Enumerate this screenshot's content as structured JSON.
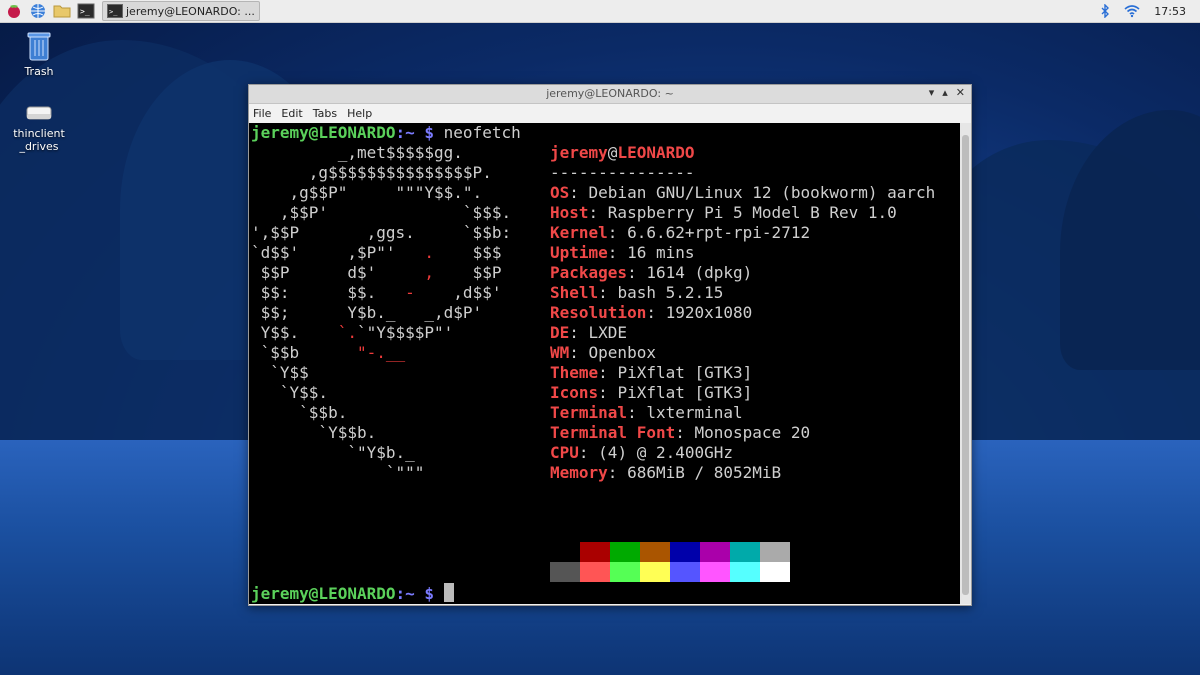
{
  "taskbar": {
    "task_label": "jeremy@LEONARDO: ...",
    "clock": "17:53"
  },
  "desktop": {
    "trash_label": "Trash",
    "drive_label": "thinclient_drives"
  },
  "window": {
    "title": "jeremy@LEONARDO: ~",
    "menu": [
      "File",
      "Edit",
      "Tabs",
      "Help"
    ]
  },
  "terminal": {
    "prompt_user": "jeremy@LEONARDO",
    "prompt_path": ":~",
    "prompt_sign": " $",
    "command": " neofetch",
    "info_user": "jeremy",
    "info_at": "@",
    "info_host": "LEONARDO",
    "separator": "---------------",
    "info": [
      {
        "key": "OS",
        "value": "Debian GNU/Linux 12 (bookworm) aarch"
      },
      {
        "key": "Host",
        "value": "Raspberry Pi 5 Model B Rev 1.0"
      },
      {
        "key": "Kernel",
        "value": "6.6.62+rpt-rpi-2712"
      },
      {
        "key": "Uptime",
        "value": "16 mins"
      },
      {
        "key": "Packages",
        "value": "1614 (dpkg)"
      },
      {
        "key": "Shell",
        "value": "bash 5.2.15"
      },
      {
        "key": "Resolution",
        "value": "1920x1080"
      },
      {
        "key": "DE",
        "value": "LXDE"
      },
      {
        "key": "WM",
        "value": "Openbox"
      },
      {
        "key": "Theme",
        "value": "PiXflat [GTK3]"
      },
      {
        "key": "Icons",
        "value": "PiXflat [GTK3]"
      },
      {
        "key": "Terminal",
        "value": "lxterminal"
      },
      {
        "key": "Terminal Font",
        "value": "Monospace 20"
      },
      {
        "key": "CPU",
        "value": "(4) @ 2.400GHz"
      },
      {
        "key": "Memory",
        "value": "686MiB / 8052MiB"
      }
    ],
    "ascii": [
      [
        "         _,met$$$$$gg.",
        ""
      ],
      [
        "      ,g$$$$$$$$$$$$$$$P.",
        ""
      ],
      [
        "    ,g$$P\"     \"\"\"Y$$.\".",
        ""
      ],
      [
        "   ,$$P'              `$$$.",
        ""
      ],
      [
        "',$$P       ,ggs.     `$$b:",
        ""
      ],
      [
        "`d$$'     ,$P\"'   ",
        ".",
        "    $$$"
      ],
      [
        " $$P      d$'     ",
        ",",
        "    $$P"
      ],
      [
        " $$:      $$.   ",
        "-",
        "    ,d$$'"
      ],
      [
        " $$;      Y$b._   _,d$P'",
        ""
      ],
      [
        " Y$$.    ",
        "`.",
        "`\"Y$$$$P\"'"
      ],
      [
        " `$$b      ",
        "\"-.__",
        ""
      ],
      [
        "  `Y$$",
        ""
      ],
      [
        "   `Y$$.",
        ""
      ],
      [
        "     `$$b.",
        ""
      ],
      [
        "       `Y$$b.",
        ""
      ],
      [
        "          `\"Y$b._",
        ""
      ],
      [
        "              `\"\"\"",
        ""
      ]
    ],
    "palette_top": [
      "#000000",
      "#aa0000",
      "#00aa00",
      "#aa5500",
      "#0000aa",
      "#aa00aa",
      "#00aaaa",
      "#aaaaaa"
    ],
    "palette_bottom": [
      "#555555",
      "#ff5555",
      "#55ff55",
      "#ffff55",
      "#5555ff",
      "#ff55ff",
      "#55ffff",
      "#ffffff"
    ]
  },
  "colors": {
    "prompt_green": "#5bd15b",
    "prompt_blue": "#7b7bff",
    "info_red": "#f04848"
  }
}
